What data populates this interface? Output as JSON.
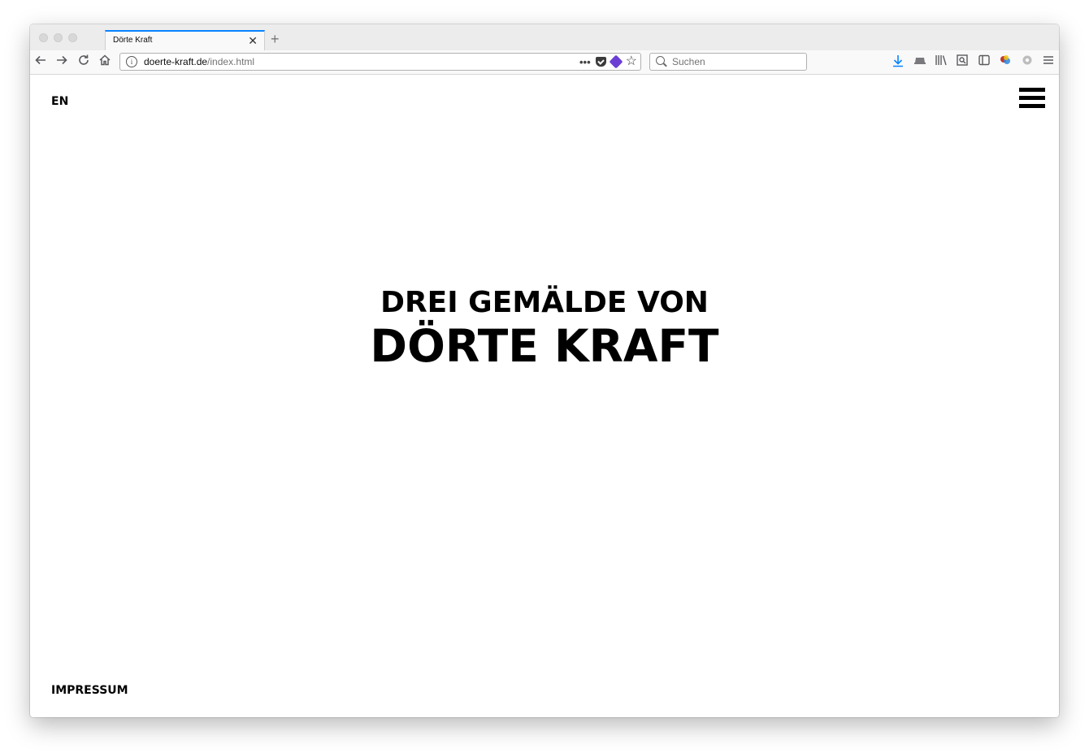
{
  "browser": {
    "tab_title": "Dörte Kraft",
    "tab_close": "✕",
    "new_tab": "+",
    "url_domain": "doerte-kraft.de",
    "url_path": "/index.html",
    "url_info": "i",
    "url_more": "•••",
    "bookmark_star": "☆",
    "search_placeholder": "Suchen",
    "nav_icons": [
      "arrow-left-icon",
      "arrow-right-icon",
      "reload-icon",
      "home-icon"
    ],
    "toolbar_icons": [
      "download-icon",
      "hat-icon",
      "library-icon",
      "screenshot-icon",
      "sidebar-icon",
      "extension-icon",
      "settings-icon",
      "menu-icon"
    ],
    "download_color": "#0a84ff",
    "accent_tab_color": "#0a84ff"
  },
  "page": {
    "lang_switch": "EN",
    "headline_line1": "DREI GEMÄLDE VON",
    "headline_line2": "DÖRTE KRAFT",
    "footer_link": "IMPRESSUM"
  }
}
